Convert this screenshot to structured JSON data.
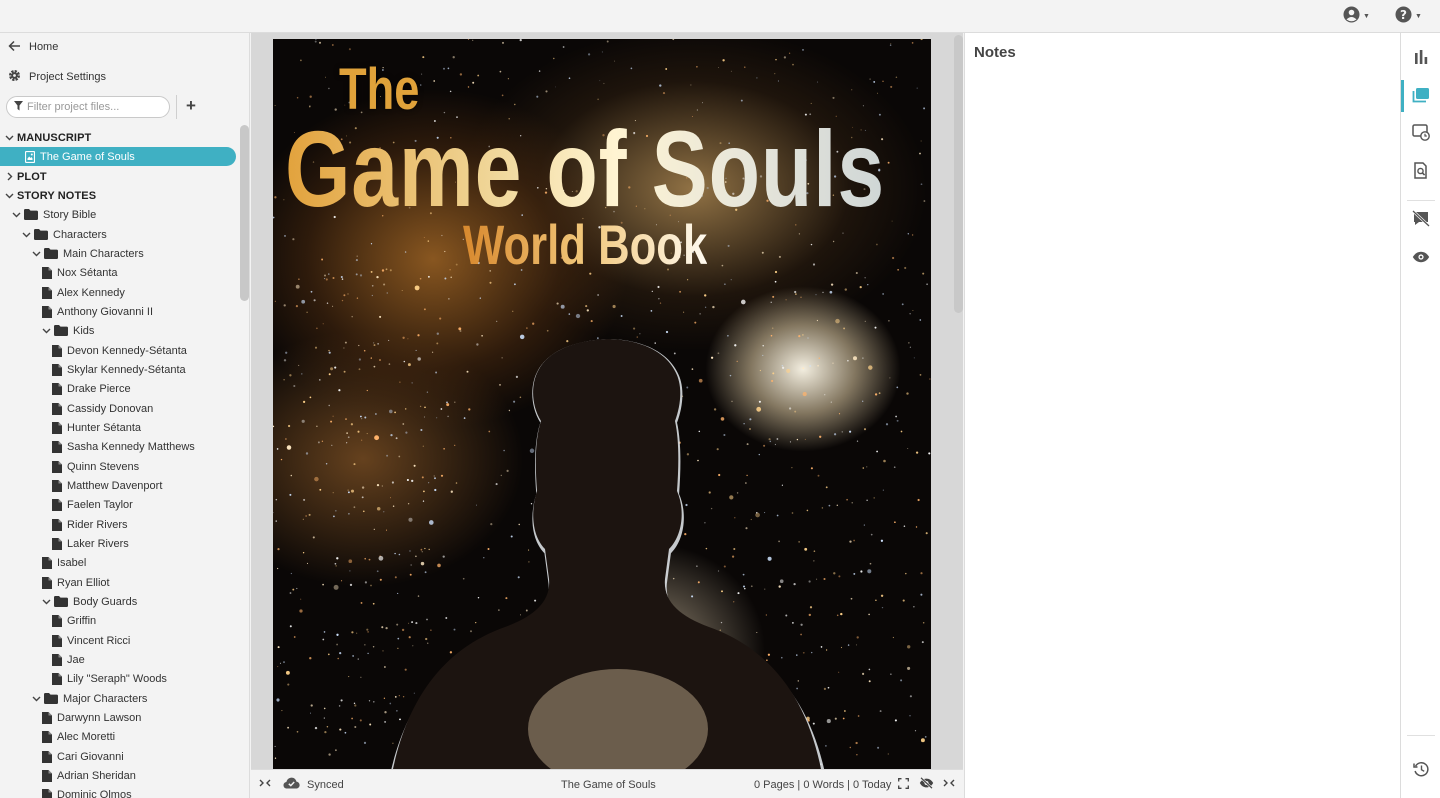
{
  "sidebar": {
    "home_label": "Home",
    "settings_label": "Project Settings",
    "filter_placeholder": "Filter project files...",
    "tree": [
      {
        "label": "MANUSCRIPT",
        "kind": "section",
        "depth": 0,
        "expanded": true
      },
      {
        "label": "The Game of Souls",
        "kind": "manuscript",
        "depth": 1,
        "selected": true
      },
      {
        "label": "PLOT",
        "kind": "section",
        "depth": 0,
        "expanded": false
      },
      {
        "label": "STORY NOTES",
        "kind": "section",
        "depth": 0,
        "expanded": true
      },
      {
        "label": "Story Bible",
        "kind": "folder",
        "depth": 1,
        "expanded": true
      },
      {
        "label": "Characters",
        "kind": "folder",
        "depth": 2,
        "expanded": true
      },
      {
        "label": "Main Characters",
        "kind": "folder",
        "depth": 3,
        "expanded": true
      },
      {
        "label": "Nox Sétanta",
        "kind": "file",
        "depth": 4
      },
      {
        "label": "Alex Kennedy",
        "kind": "file",
        "depth": 4
      },
      {
        "label": "Anthony Giovanni II",
        "kind": "file",
        "depth": 4
      },
      {
        "label": "Kids",
        "kind": "folder",
        "depth": 4,
        "expanded": true
      },
      {
        "label": "Devon Kennedy-Sétanta",
        "kind": "file",
        "depth": 5
      },
      {
        "label": "Skylar Kennedy-Sétanta",
        "kind": "file",
        "depth": 5
      },
      {
        "label": "Drake Pierce",
        "kind": "file",
        "depth": 5
      },
      {
        "label": "Cassidy Donovan",
        "kind": "file",
        "depth": 5
      },
      {
        "label": "Hunter Sétanta",
        "kind": "file",
        "depth": 5
      },
      {
        "label": "Sasha Kennedy Matthews",
        "kind": "file",
        "depth": 5
      },
      {
        "label": "Quinn Stevens",
        "kind": "file",
        "depth": 5
      },
      {
        "label": "Matthew Davenport",
        "kind": "file",
        "depth": 5
      },
      {
        "label": "Faelen Taylor",
        "kind": "file",
        "depth": 5
      },
      {
        "label": "Rider Rivers",
        "kind": "file",
        "depth": 5
      },
      {
        "label": "Laker Rivers",
        "kind": "file",
        "depth": 5
      },
      {
        "label": "Isabel",
        "kind": "file",
        "depth": 4
      },
      {
        "label": "Ryan Elliot",
        "kind": "file",
        "depth": 4
      },
      {
        "label": "Body Guards",
        "kind": "folder",
        "depth": 4,
        "expanded": true
      },
      {
        "label": "Griffin",
        "kind": "file",
        "depth": 5
      },
      {
        "label": "Vincent Ricci",
        "kind": "file",
        "depth": 5
      },
      {
        "label": "Jae",
        "kind": "file",
        "depth": 5
      },
      {
        "label": "Lily \"Seraph\" Woods",
        "kind": "file",
        "depth": 5
      },
      {
        "label": "Major Characters",
        "kind": "folder",
        "depth": 3,
        "expanded": true
      },
      {
        "label": "Darwynn Lawson",
        "kind": "file",
        "depth": 4
      },
      {
        "label": "Alec Moretti",
        "kind": "file",
        "depth": 4
      },
      {
        "label": "Cari Giovanni",
        "kind": "file",
        "depth": 4
      },
      {
        "label": "Adrian Sheridan",
        "kind": "file",
        "depth": 4
      },
      {
        "label": "Dominic Olmos",
        "kind": "file",
        "depth": 4
      }
    ]
  },
  "cover": {
    "line1": "The",
    "line2": "Game of Souls",
    "line3": "World Book"
  },
  "statusbar": {
    "sync_label": "Synced",
    "doc_title": "The Game of Souls",
    "stats": "0 Pages | 0 Words | 0 Today"
  },
  "notes": {
    "title": "Notes"
  },
  "colors": {
    "accent": "#3fb0c3",
    "sidebar_bg": "#f3f3f3",
    "editor_bg": "#d7d7d7"
  },
  "rail_icons": [
    "bar-chart-icon",
    "notes-cards-icon",
    "timeline-icon",
    "search-document-icon",
    "hide-comments-icon",
    "eye-icon",
    "history-icon"
  ]
}
